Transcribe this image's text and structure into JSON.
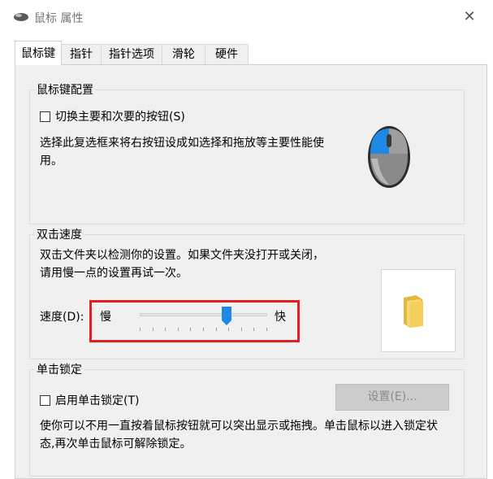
{
  "window": {
    "title": "鼠标 属性",
    "close_glyph": "✕"
  },
  "tabs": [
    {
      "label": "鼠标键",
      "active": true
    },
    {
      "label": "指针"
    },
    {
      "label": "指针选项"
    },
    {
      "label": "滑轮"
    },
    {
      "label": "硬件"
    }
  ],
  "buttons_config": {
    "title": "鼠标键配置",
    "switch_label": "切换主要和次要的按钮(S)",
    "switch_checked": false,
    "description": "选择此复选框来将右按钮设成如选择和拖放等主要性能使用。"
  },
  "double_click": {
    "title": "双击速度",
    "description": "双击文件夹以检测你的设置。如果文件夹没打开或关闭，请用慢一点的设置再试一次。",
    "speed_label": "速度(D):",
    "slow_label": "慢",
    "fast_label": "快",
    "speed_value_fraction": 0.68
  },
  "click_lock": {
    "title": "单击锁定",
    "enable_label": "启用单击锁定(T)",
    "enable_checked": false,
    "settings_button": "设置(E)...",
    "description": "使你可以不用一直按着鼠标按钮就可以突出显示或拖拽。单击鼠标以进入锁定状态,再次单击鼠标可解除锁定。"
  },
  "colors": {
    "accent_blue": "#1e88e5",
    "highlight_red": "#e02020",
    "folder_yellow": "#f3cf5a"
  },
  "icons": [
    "mouse-app-icon",
    "close-icon",
    "mouse-device-icon",
    "folder-icon",
    "slider-thumb-icon"
  ]
}
